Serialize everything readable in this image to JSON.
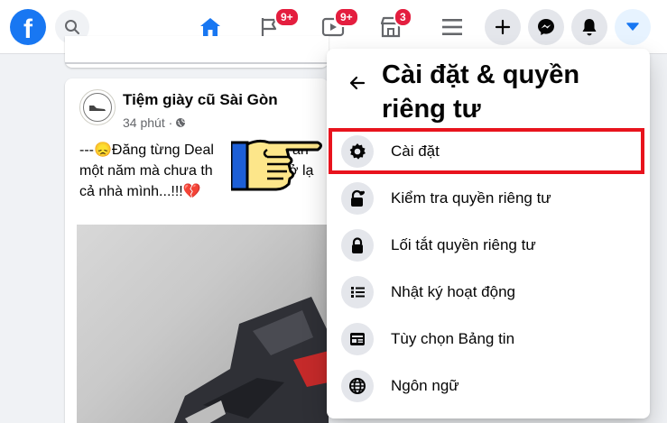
{
  "nav": {
    "logo_glyph": "f",
    "badges": {
      "pages": "9+",
      "watch": "9+",
      "marketplace": "3"
    }
  },
  "post": {
    "author": "Tiệm giày cũ Sài Gòn",
    "time": "34 phút · ",
    "text_lines": [
      "---😞Đăng từng Deal",
      "một năm mà chưa th",
      "cả nhà mình...!!!💔"
    ],
    "text_fragments": [
      "án",
      "ở lạ",
      "ở"
    ]
  },
  "dropdown": {
    "title": "Cài đặt & quyền riêng tư",
    "items": [
      {
        "label": "Cài đặt",
        "icon": "gear-icon"
      },
      {
        "label": "Kiểm tra quyền riêng tư",
        "icon": "lock-heart-icon"
      },
      {
        "label": "Lối tắt quyền riêng tư",
        "icon": "lock-icon"
      },
      {
        "label": "Nhật ký hoạt động",
        "icon": "list-icon"
      },
      {
        "label": "Tùy chọn Bảng tin",
        "icon": "feed-icon"
      },
      {
        "label": "Ngôn ngữ",
        "icon": "globe-icon"
      }
    ]
  },
  "colors": {
    "brand": "#1877f2",
    "badge": "#e41e3f",
    "highlight": "#e8131d"
  }
}
